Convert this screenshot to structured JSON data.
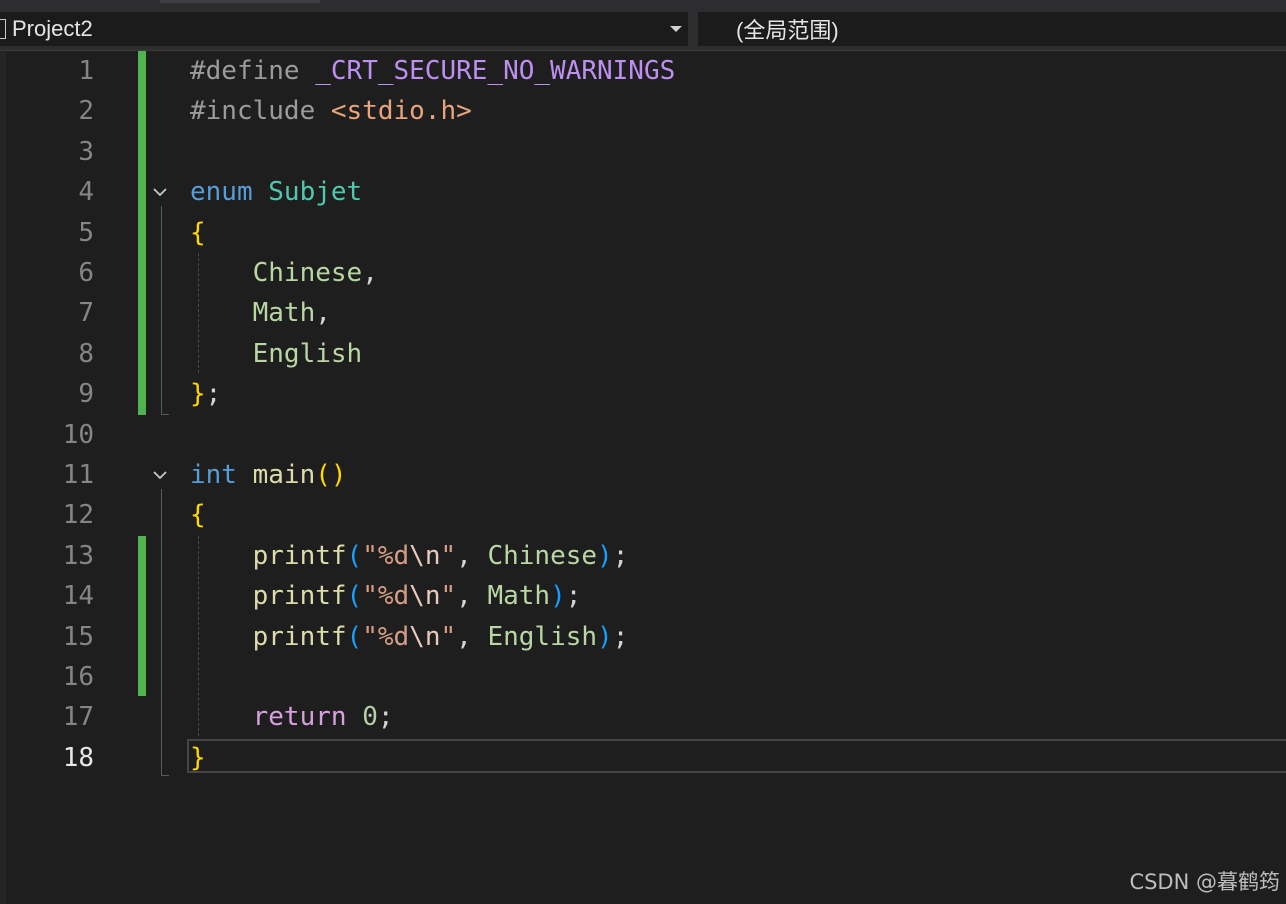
{
  "navbar": {
    "project": "Project2",
    "scope": "(全局范围)"
  },
  "colors": {
    "background": "#1e1e1e",
    "change_bar": "#4fb34f",
    "keyword": "#569cd6",
    "type": "#4ec9b0",
    "function": "#dcdcaa",
    "string": "#d69d85",
    "enum_member": "#b8d7a3",
    "macro": "#bd8ff0"
  },
  "editor": {
    "current_line": 18,
    "lines": [
      {
        "n": "1",
        "tokens": [
          [
            "#define ",
            "t-pp"
          ],
          [
            "_CRT_SECURE_NO_WARNINGS",
            "t-macro"
          ]
        ]
      },
      {
        "n": "2",
        "tokens": [
          [
            "#include ",
            "t-pp"
          ],
          [
            "<stdio.h>",
            "t-inc"
          ]
        ]
      },
      {
        "n": "3",
        "tokens": []
      },
      {
        "n": "4",
        "tokens": [
          [
            "enum ",
            "t-kw"
          ],
          [
            "Subjet",
            "t-type"
          ]
        ]
      },
      {
        "n": "5",
        "tokens": [
          [
            "{",
            "t-br"
          ]
        ]
      },
      {
        "n": "6",
        "tokens": [
          [
            "    ",
            "t-p"
          ],
          [
            "Chinese",
            "t-enum"
          ],
          [
            ",",
            "t-p"
          ]
        ]
      },
      {
        "n": "7",
        "tokens": [
          [
            "    ",
            "t-p"
          ],
          [
            "Math",
            "t-enum"
          ],
          [
            ",",
            "t-p"
          ]
        ]
      },
      {
        "n": "8",
        "tokens": [
          [
            "    ",
            "t-p"
          ],
          [
            "English",
            "t-enum"
          ]
        ]
      },
      {
        "n": "9",
        "tokens": [
          [
            "}",
            "t-br"
          ],
          [
            ";",
            "t-p"
          ]
        ]
      },
      {
        "n": "10",
        "tokens": []
      },
      {
        "n": "11",
        "tokens": [
          [
            "int ",
            "t-kw"
          ],
          [
            "main",
            "t-fn"
          ],
          [
            "()",
            "t-br"
          ]
        ]
      },
      {
        "n": "12",
        "tokens": [
          [
            "{",
            "t-br"
          ]
        ]
      },
      {
        "n": "13",
        "tokens": [
          [
            "    ",
            "t-p"
          ],
          [
            "printf",
            "t-fn"
          ],
          [
            "(",
            "t-br3"
          ],
          [
            "\"%d",
            "t-str"
          ],
          [
            "\\n",
            "t-esc"
          ],
          [
            "\"",
            "t-str"
          ],
          [
            ", ",
            "t-p"
          ],
          [
            "Chinese",
            "t-enum"
          ],
          [
            ")",
            "t-br3"
          ],
          [
            ";",
            "t-p"
          ]
        ]
      },
      {
        "n": "14",
        "tokens": [
          [
            "    ",
            "t-p"
          ],
          [
            "printf",
            "t-fn"
          ],
          [
            "(",
            "t-br3"
          ],
          [
            "\"%d",
            "t-str"
          ],
          [
            "\\n",
            "t-esc"
          ],
          [
            "\"",
            "t-str"
          ],
          [
            ", ",
            "t-p"
          ],
          [
            "Math",
            "t-enum"
          ],
          [
            ")",
            "t-br3"
          ],
          [
            ";",
            "t-p"
          ]
        ]
      },
      {
        "n": "15",
        "tokens": [
          [
            "    ",
            "t-p"
          ],
          [
            "printf",
            "t-fn"
          ],
          [
            "(",
            "t-br3"
          ],
          [
            "\"%d",
            "t-str"
          ],
          [
            "\\n",
            "t-esc"
          ],
          [
            "\"",
            "t-str"
          ],
          [
            ", ",
            "t-p"
          ],
          [
            "English",
            "t-enum"
          ],
          [
            ")",
            "t-br3"
          ],
          [
            ";",
            "t-p"
          ]
        ]
      },
      {
        "n": "16",
        "tokens": []
      },
      {
        "n": "17",
        "tokens": [
          [
            "    ",
            "t-p"
          ],
          [
            "return ",
            "t-ctl"
          ],
          [
            "0",
            "t-num"
          ],
          [
            ";",
            "t-p"
          ]
        ]
      },
      {
        "n": "18",
        "tokens": [
          [
            "}",
            "t-br"
          ]
        ]
      }
    ]
  },
  "watermark": "CSDN @暮鹤筠"
}
